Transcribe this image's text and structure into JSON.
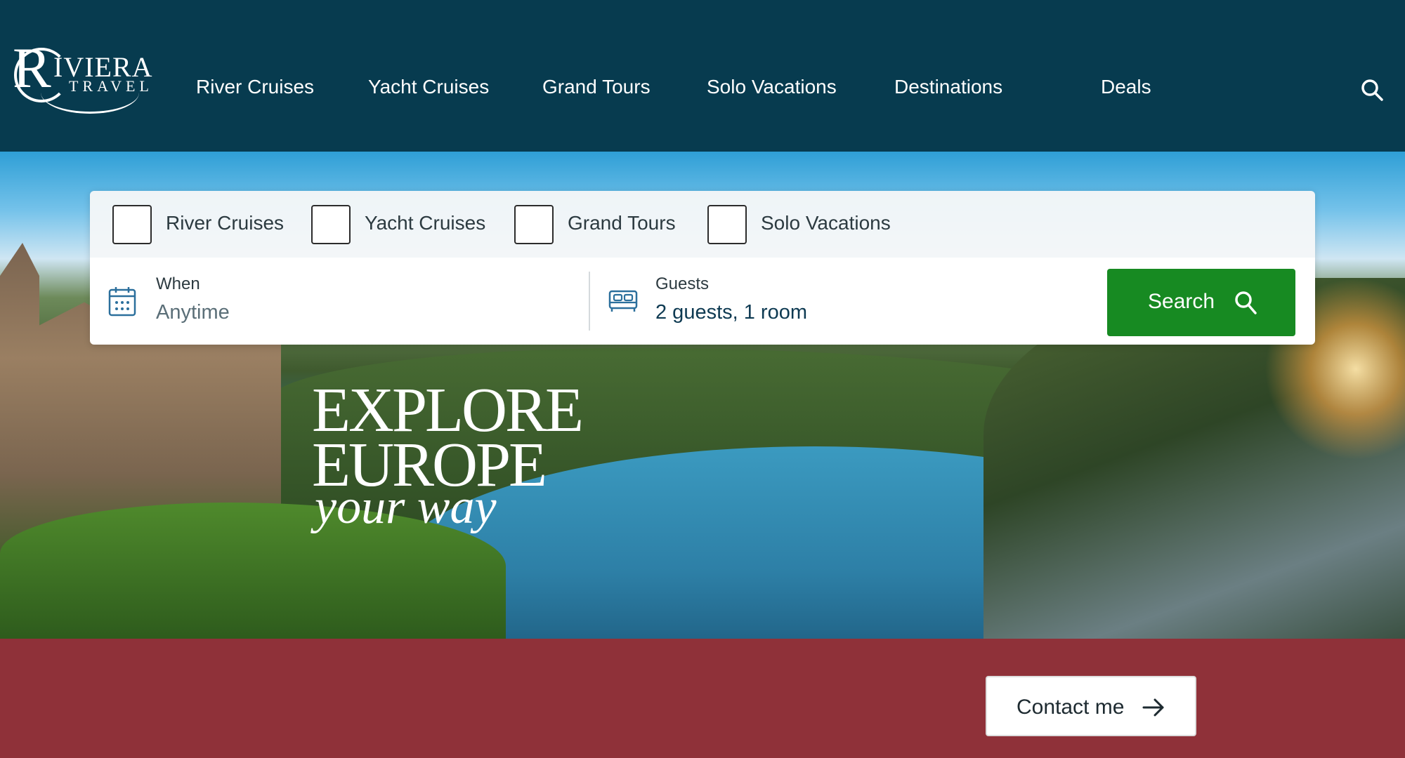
{
  "brand": {
    "logo_text": "RIVIERA",
    "logo_sub": "TRAVEL"
  },
  "nav": {
    "items": [
      {
        "label": "River Cruises"
      },
      {
        "label": "Yacht Cruises"
      },
      {
        "label": "Grand Tours"
      },
      {
        "label": "Solo Vacations"
      },
      {
        "label": "Destinations"
      },
      {
        "label": "Deals"
      }
    ],
    "search_icon": "search-icon"
  },
  "search_panel": {
    "checkboxes": [
      {
        "label": "River Cruises",
        "checked": false
      },
      {
        "label": "Yacht Cruises",
        "checked": false
      },
      {
        "label": "Grand Tours",
        "checked": false
      },
      {
        "label": "Solo Vacations",
        "checked": false
      }
    ],
    "when": {
      "label": "When",
      "value": "Anytime",
      "icon": "calendar-icon"
    },
    "guests": {
      "label": "Guests",
      "value": "2 guests, 1 room",
      "icon": "bed-icon"
    },
    "search_button": {
      "label": "Search",
      "icon": "search-icon"
    }
  },
  "hero": {
    "line1": "EXPLORE",
    "line2": "EUROPE",
    "line3": "your way"
  },
  "footer": {
    "contact_button": {
      "label": "Contact me",
      "icon": "arrow-right-icon"
    }
  },
  "colors": {
    "header_bg": "#073b4f",
    "search_button": "#178a22",
    "bottom_bar": "#8f3139",
    "field_value_muted": "#5b6f78",
    "field_value_dark": "#0e3a52"
  }
}
